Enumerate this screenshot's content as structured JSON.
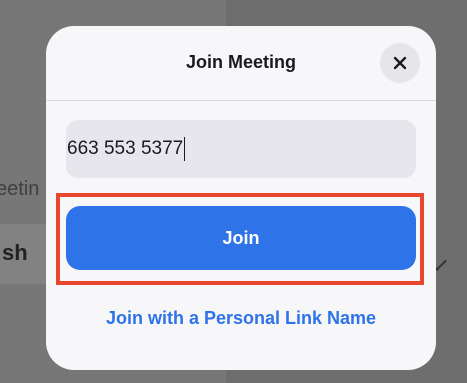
{
  "background": {
    "meeting_text": "eetin",
    "button_text": "sh"
  },
  "dialog": {
    "title": "Join Meeting",
    "close_icon": "close-icon",
    "meeting_id_value": "663 553 5377",
    "join_label": "Join",
    "personal_link_label": "Join with a Personal Link Name"
  },
  "colors": {
    "accent": "#2f73e8",
    "highlight": "#e8462f",
    "dialog_bg": "#f7f7f9",
    "input_bg": "#e6e6ec"
  }
}
